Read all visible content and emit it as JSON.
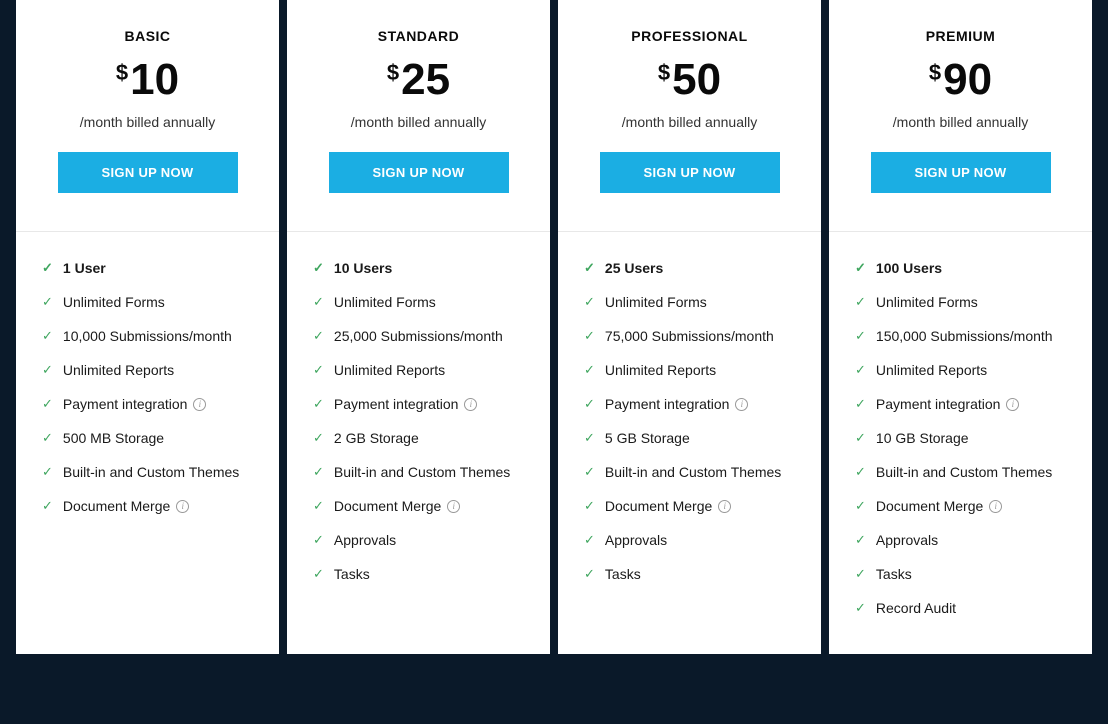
{
  "plans": [
    {
      "name": "BASIC",
      "currency": "$",
      "price": "10",
      "cycle": "/month billed annually",
      "cta": "SIGN UP NOW",
      "features": [
        {
          "text": "1 User",
          "bold": true,
          "info": false
        },
        {
          "text": "Unlimited Forms",
          "bold": false,
          "info": false
        },
        {
          "text": "10,000 Submissions/month",
          "bold": false,
          "info": false
        },
        {
          "text": "Unlimited Reports",
          "bold": false,
          "info": false
        },
        {
          "text": "Payment integration",
          "bold": false,
          "info": true
        },
        {
          "text": "500 MB Storage",
          "bold": false,
          "info": false
        },
        {
          "text": "Built-in and Custom Themes",
          "bold": false,
          "info": false
        },
        {
          "text": "Document Merge",
          "bold": false,
          "info": true
        }
      ]
    },
    {
      "name": "STANDARD",
      "currency": "$",
      "price": "25",
      "cycle": "/month billed annually",
      "cta": "SIGN UP NOW",
      "features": [
        {
          "text": "10 Users",
          "bold": true,
          "info": false
        },
        {
          "text": "Unlimited Forms",
          "bold": false,
          "info": false
        },
        {
          "text": "25,000 Submissions/month",
          "bold": false,
          "info": false
        },
        {
          "text": "Unlimited Reports",
          "bold": false,
          "info": false
        },
        {
          "text": "Payment integration",
          "bold": false,
          "info": true
        },
        {
          "text": "2 GB Storage",
          "bold": false,
          "info": false
        },
        {
          "text": "Built-in and Custom Themes",
          "bold": false,
          "info": false
        },
        {
          "text": "Document Merge",
          "bold": false,
          "info": true
        },
        {
          "text": "Approvals",
          "bold": false,
          "info": false
        },
        {
          "text": "Tasks",
          "bold": false,
          "info": false
        }
      ]
    },
    {
      "name": "PROFESSIONAL",
      "currency": "$",
      "price": "50",
      "cycle": "/month billed annually",
      "cta": "SIGN UP NOW",
      "features": [
        {
          "text": "25 Users",
          "bold": true,
          "info": false
        },
        {
          "text": "Unlimited Forms",
          "bold": false,
          "info": false
        },
        {
          "text": "75,000 Submissions/month",
          "bold": false,
          "info": false
        },
        {
          "text": "Unlimited Reports",
          "bold": false,
          "info": false
        },
        {
          "text": "Payment integration",
          "bold": false,
          "info": true
        },
        {
          "text": "5 GB Storage",
          "bold": false,
          "info": false
        },
        {
          "text": "Built-in and Custom Themes",
          "bold": false,
          "info": false
        },
        {
          "text": "Document Merge",
          "bold": false,
          "info": true
        },
        {
          "text": "Approvals",
          "bold": false,
          "info": false
        },
        {
          "text": "Tasks",
          "bold": false,
          "info": false
        }
      ]
    },
    {
      "name": "PREMIUM",
      "currency": "$",
      "price": "90",
      "cycle": "/month billed annually",
      "cta": "SIGN UP NOW",
      "features": [
        {
          "text": "100 Users",
          "bold": true,
          "info": false
        },
        {
          "text": "Unlimited Forms",
          "bold": false,
          "info": false
        },
        {
          "text": "150,000 Submissions/month",
          "bold": false,
          "info": false
        },
        {
          "text": "Unlimited Reports",
          "bold": false,
          "info": false
        },
        {
          "text": "Payment integration",
          "bold": false,
          "info": true
        },
        {
          "text": "10 GB Storage",
          "bold": false,
          "info": false
        },
        {
          "text": "Built-in and Custom Themes",
          "bold": false,
          "info": false
        },
        {
          "text": "Document Merge",
          "bold": false,
          "info": true
        },
        {
          "text": "Approvals",
          "bold": false,
          "info": false
        },
        {
          "text": "Tasks",
          "bold": false,
          "info": false
        },
        {
          "text": "Record Audit",
          "bold": false,
          "info": false
        }
      ]
    }
  ]
}
